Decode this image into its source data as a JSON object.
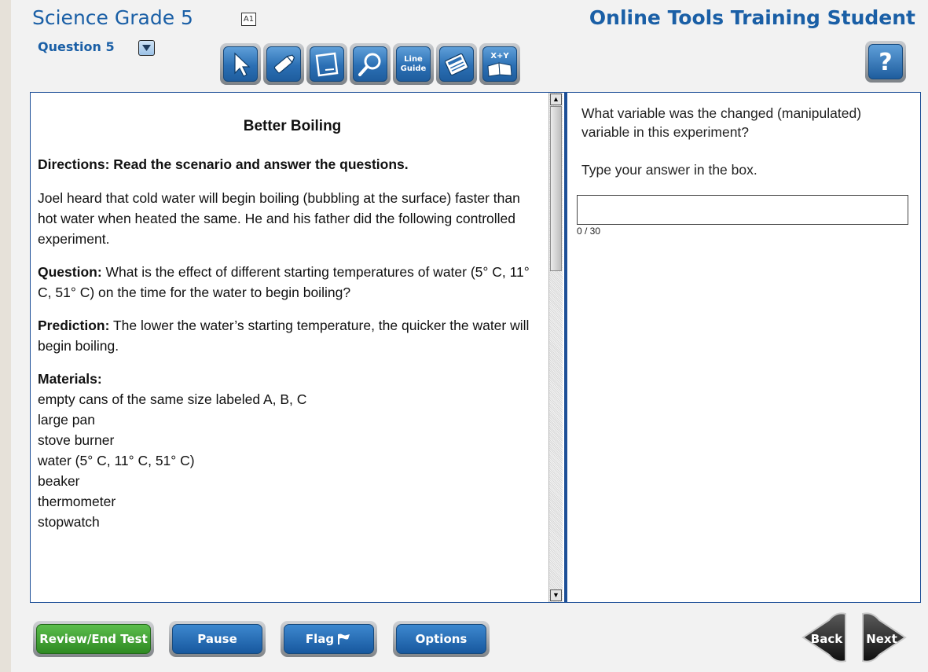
{
  "header": {
    "test_title": "Science Grade 5",
    "accessibility_badge": "A1",
    "student_name": "Online Tools Training Student",
    "question_label": "Question 5"
  },
  "toolbar": [
    {
      "name": "pointer-tool",
      "icon": "arrow-pointer-icon"
    },
    {
      "name": "highlighter-tool",
      "icon": "highlighter-icon"
    },
    {
      "name": "notepad-tool",
      "icon": "notepad-icon"
    },
    {
      "name": "magnifier-tool",
      "icon": "magnifier-icon"
    },
    {
      "name": "line-guide-tool",
      "icon": "line-guide-icon",
      "label_1": "Line",
      "label_2": "Guide"
    },
    {
      "name": "calculator-tool",
      "icon": "calculator-icon"
    },
    {
      "name": "formula-reference-tool",
      "icon": "formula-book-icon",
      "label": "X+Y"
    }
  ],
  "help": {
    "label": "?",
    "icon": "help-icon"
  },
  "passage": {
    "title": "Better Boiling",
    "directions": "Directions: Read the scenario and answer the questions.",
    "intro": "Joel heard that cold water will begin boiling (bubbling at the surface) faster than hot water when heated the same. He and his father did the following controlled experiment.",
    "question_label": "Question:",
    "question_text": " What is the effect of different starting temperatures of water (5° C, 11° C, 51° C) on the time for the water to begin boiling?",
    "prediction_label": "Prediction:",
    "prediction_text": " The lower the water’s starting temperature, the quicker the water will begin boiling.",
    "materials_label": "Materials:",
    "materials": [
      "empty cans of the same size labeled A, B, C",
      "large pan",
      "stove burner",
      "water (5° C, 11° C, 51° C)",
      "beaker",
      "thermometer",
      "stopwatch"
    ]
  },
  "question": {
    "prompt": "What variable was the changed (manipulated) variable in this experiment?",
    "instruction": "Type your answer in the box.",
    "answer_value": "",
    "char_count": "0 / 30"
  },
  "footer": {
    "review_label": "Review/End Test",
    "pause_label": "Pause",
    "flag_label": "Flag",
    "options_label": "Options",
    "back_label": "Back",
    "next_label": "Next"
  },
  "colors": {
    "title_blue": "#1a5fa6",
    "pane_border": "#1d4f97",
    "button_blue": "#17589e",
    "button_green": "#2e8a22",
    "nav_dark": "#1a1a1a"
  }
}
